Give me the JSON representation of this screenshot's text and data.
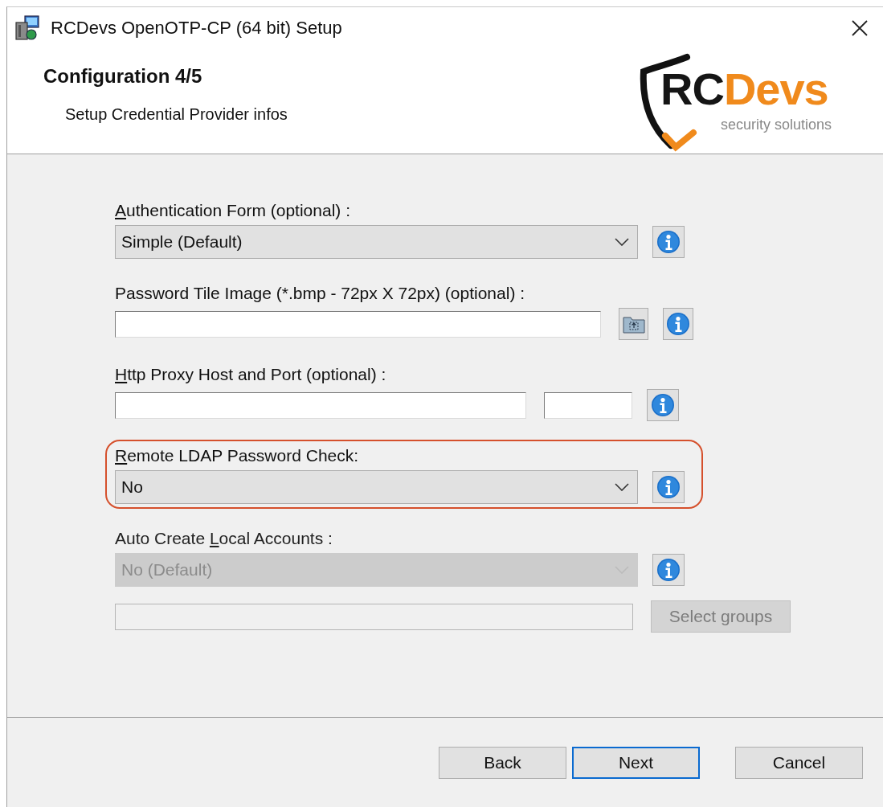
{
  "window": {
    "title": "RCDevs OpenOTP-CP (64 bit) Setup"
  },
  "header": {
    "title": "Configuration 4/5",
    "subtitle": "Setup Credential Provider infos",
    "logo": {
      "dark": "RC",
      "accent": "Devs",
      "tagline": "security solutions"
    }
  },
  "fields": [
    {
      "kind": "dropdown",
      "label": {
        "key": "A",
        "rest": "uthentication Form (optional) :"
      },
      "value": "Simple (Default)",
      "disabled": false,
      "highlighted": false
    },
    {
      "kind": "file",
      "label": {
        "rest": "Password Tile Image (*.bmp - 72px X 72px) (optional) :"
      }
    },
    {
      "kind": "host_port",
      "label": {
        "key": "H",
        "rest": "ttp Proxy Host and Port (optional) :"
      }
    },
    {
      "kind": "dropdown",
      "label": {
        "key": "R",
        "rest": "emote LDAP Password Check:"
      },
      "value": "No",
      "disabled": false,
      "highlighted": true
    },
    {
      "kind": "dropdown",
      "label": {
        "pre": "Auto Create ",
        "key": "L",
        "rest": "ocal Accounts :"
      },
      "value": "No (Default)",
      "disabled": true,
      "highlighted": false
    },
    {
      "kind": "group_picker",
      "button": "Select groups",
      "disabled": true
    }
  ],
  "buttons": [
    {
      "label": "Back",
      "default": false
    },
    {
      "label": "Next",
      "default": true
    },
    {
      "label": "Cancel",
      "default": false
    }
  ]
}
